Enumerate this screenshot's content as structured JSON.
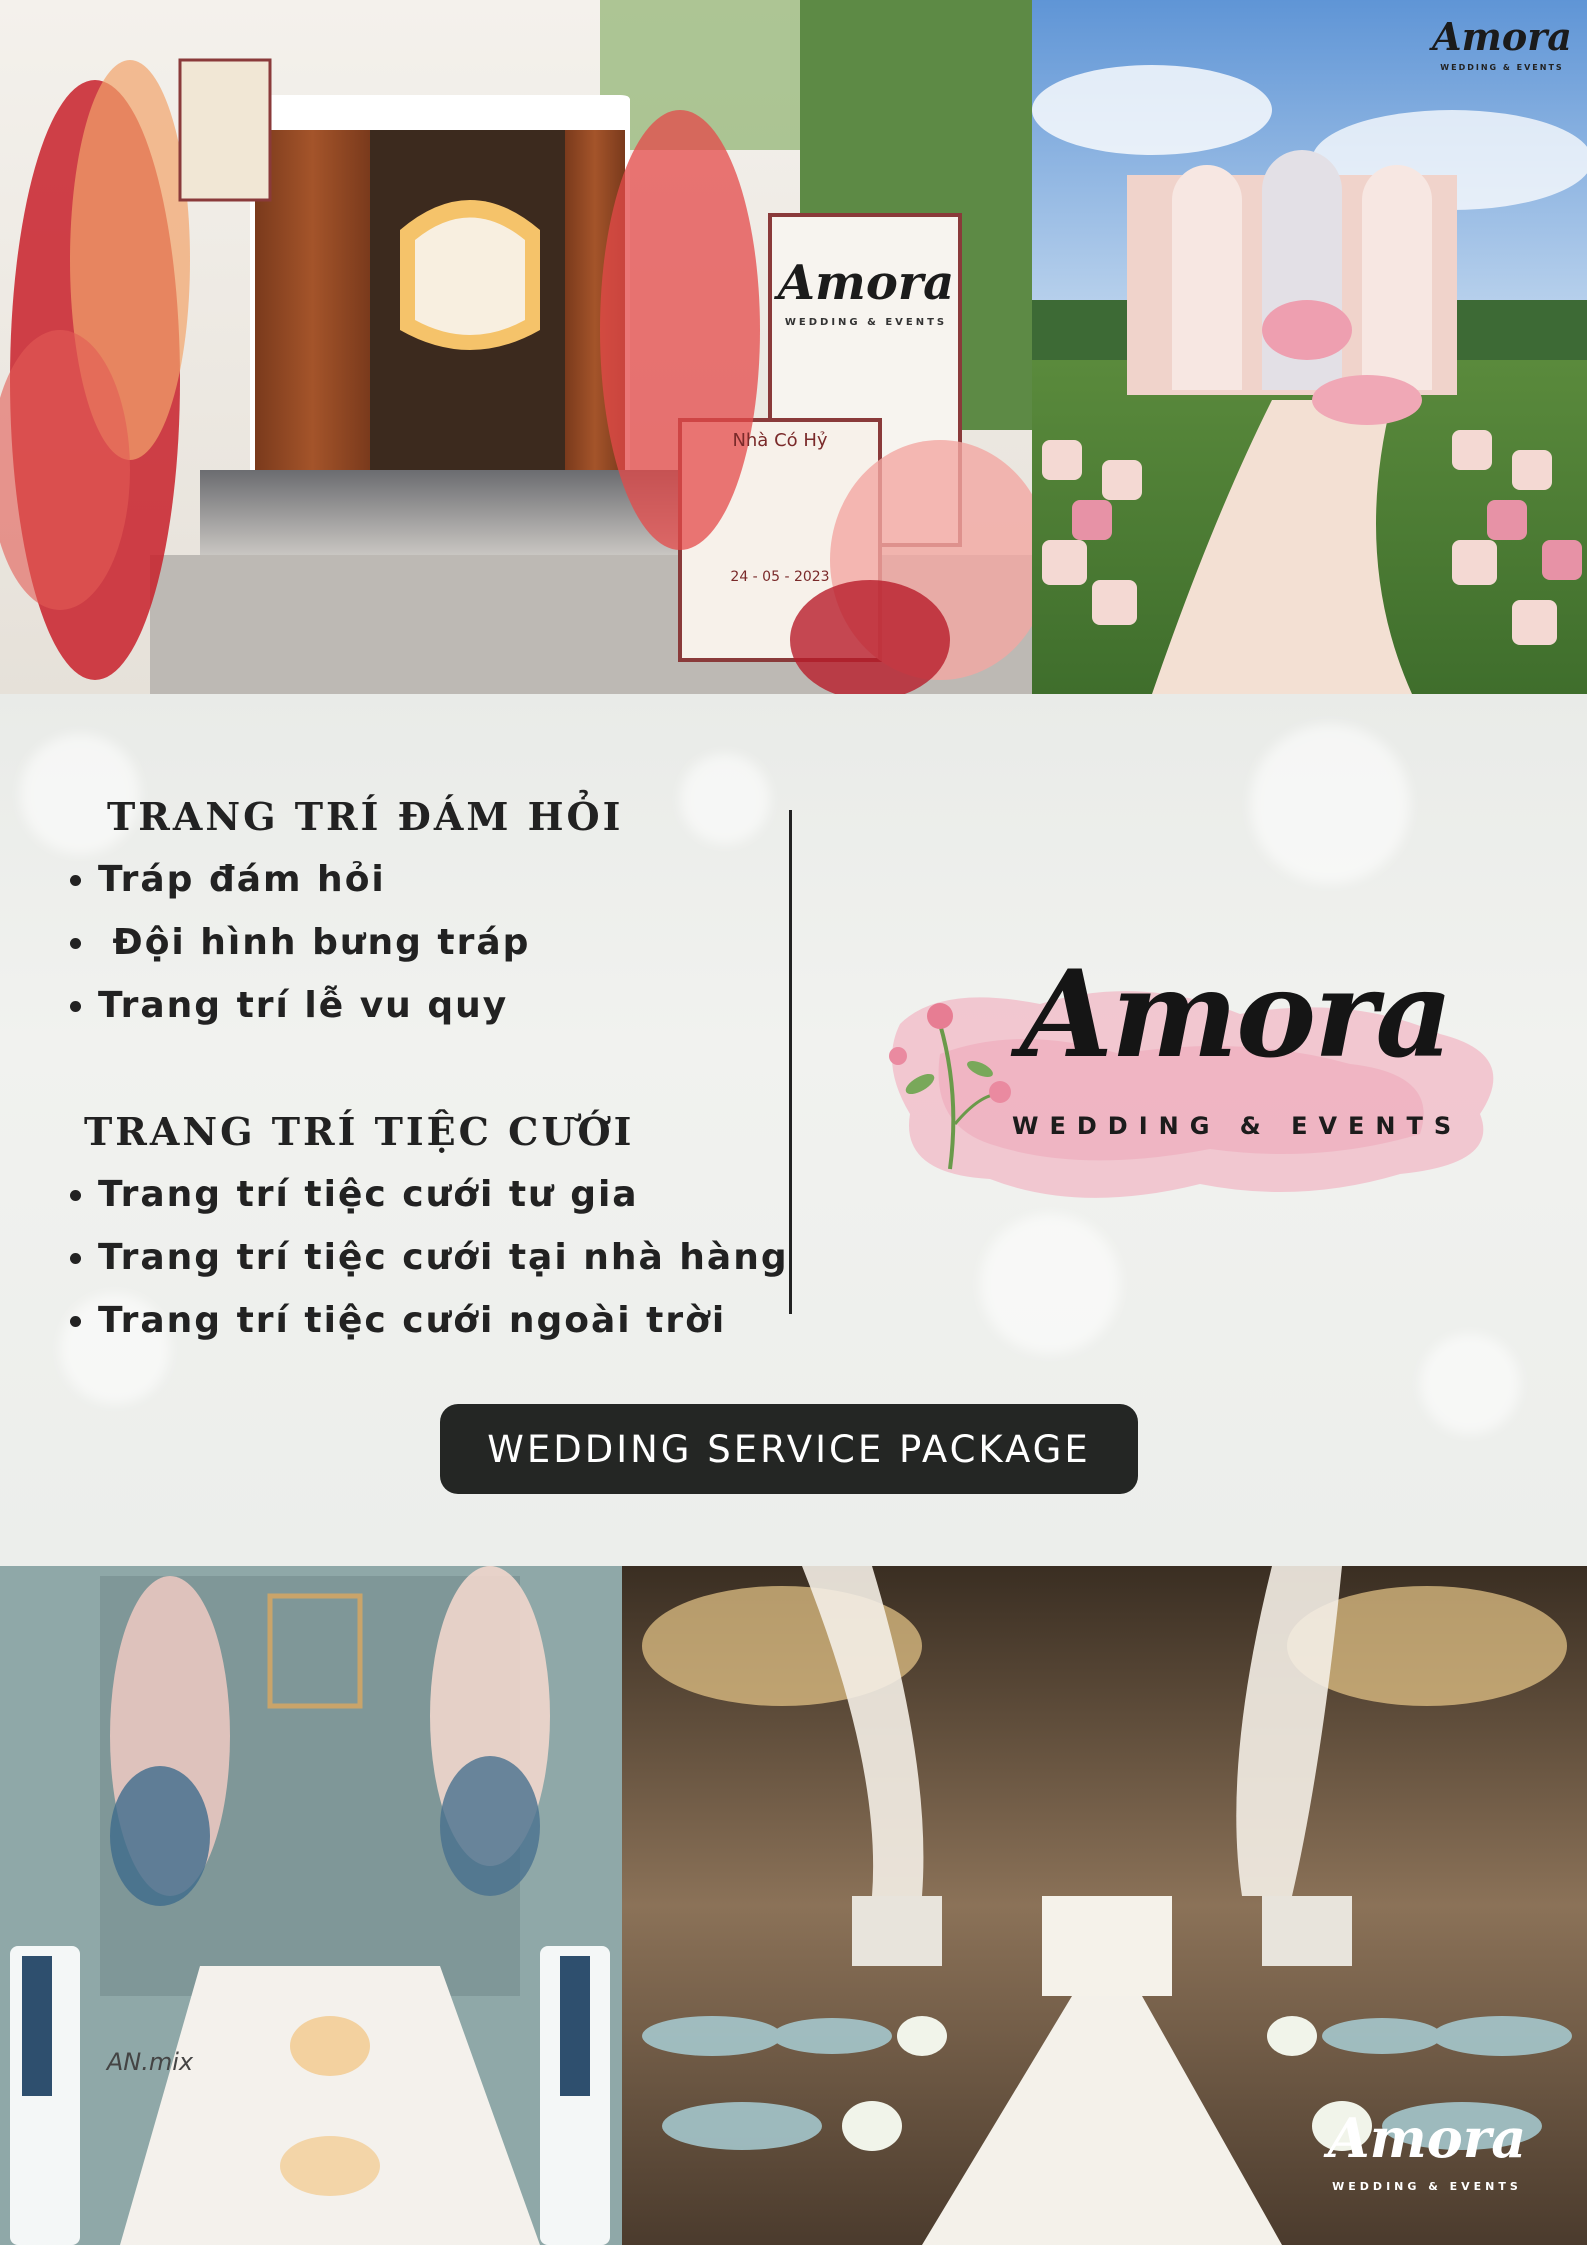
{
  "photos": {
    "engagement_gate": {
      "signboard_brand": "Amora",
      "signboard_tagline": "WEDDING & EVENTS",
      "welcome_sign": "Nhà Có Hỷ",
      "welcome_date": "24 - 05 - 2023"
    },
    "outdoor_ceremony": {
      "brand": "Amora",
      "tagline": "WEDDING & EVENTS"
    },
    "table_setup": {
      "watermark": "AN.mix"
    },
    "ballroom": {
      "brand": "Amora",
      "tagline": "WEDDING & EVENTS"
    }
  },
  "sections": [
    {
      "heading": "TRANG TRÍ ĐÁM HỎI",
      "items": [
        "Tráp đám hỏi",
        " Đội hình bưng tráp",
        "Trang trí lễ vu quy"
      ]
    },
    {
      "heading": "TRANG TRÍ TIỆC CƯỚI",
      "items": [
        "Trang trí tiệc cưới tư gia",
        "Trang trí tiệc cưới tại nhà hàng",
        "Trang trí tiệc cưới ngoài trời"
      ]
    }
  ],
  "logo": {
    "name": "Amora",
    "tagline": "WEDDING & EVENTS"
  },
  "package_button": "WEDDING SERVICE PACKAGE",
  "colors": {
    "text_dark": "#222222",
    "button_bg": "#242624",
    "button_text": "#ffffff",
    "logo_wash": "#f2b8c6"
  }
}
